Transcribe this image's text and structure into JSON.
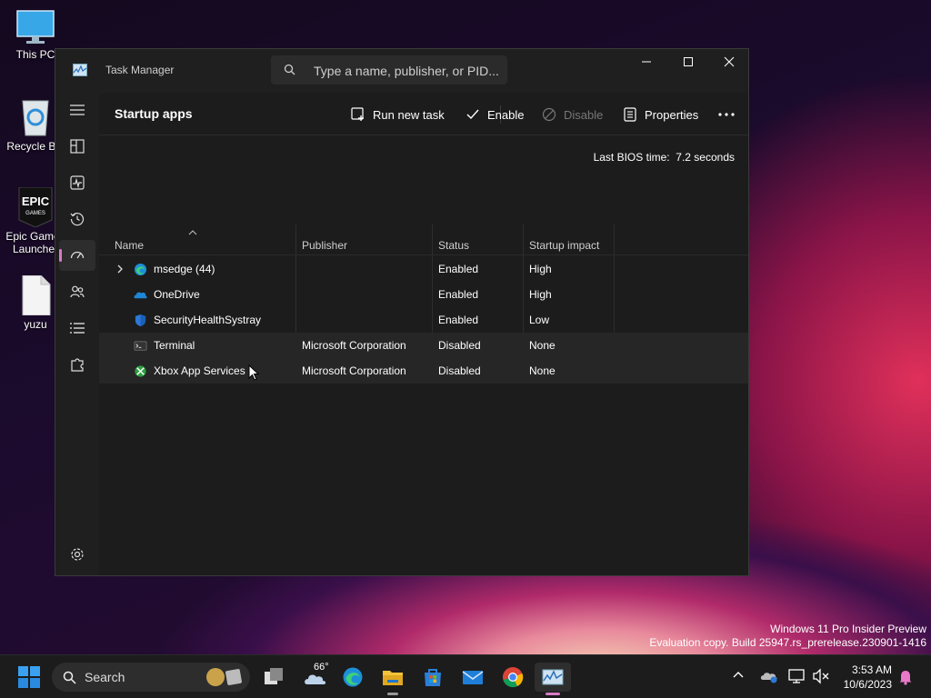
{
  "desktop": {
    "icons": [
      {
        "label": "This PC"
      },
      {
        "label": "Recycle Bin"
      },
      {
        "label": "Epic Games Launcher"
      },
      {
        "label": "yuzu"
      }
    ],
    "watermark": {
      "line1": "Windows 11 Pro Insider Preview",
      "line2": "Evaluation copy. Build 25947.rs_prerelease.230901-1416"
    }
  },
  "window": {
    "title": "Task Manager",
    "search_placeholder": "Type a name, publisher, or PID...",
    "page_title": "Startup apps",
    "toolbar": {
      "run_new_task": "Run new task",
      "enable": "Enable",
      "disable": "Disable",
      "properties": "Properties"
    },
    "bios_label": "Last BIOS time:",
    "bios_value": "7.2 seconds",
    "columns": [
      "Name",
      "Publisher",
      "Status",
      "Startup impact"
    ],
    "rows": [
      {
        "name": "msedge (44)",
        "publisher": "",
        "status": "Enabled",
        "impact": "High",
        "icon": "edge-icon"
      },
      {
        "name": "OneDrive",
        "publisher": "",
        "status": "Enabled",
        "impact": "High",
        "icon": "onedrive-icon"
      },
      {
        "name": "SecurityHealthSystray",
        "publisher": "",
        "status": "Enabled",
        "impact": "Low",
        "icon": "shield-icon"
      },
      {
        "name": "Terminal",
        "publisher": "Microsoft Corporation",
        "status": "Disabled",
        "impact": "None",
        "icon": "terminal-icon"
      },
      {
        "name": "Xbox App Services",
        "publisher": "Microsoft Corporation",
        "status": "Disabled",
        "impact": "None",
        "icon": "xbox-icon"
      }
    ]
  },
  "taskbar": {
    "search_label": "Search",
    "weather_temp": "66°",
    "time": "3:53 AM",
    "date": "10/6/2023"
  },
  "colors": {
    "accent": "#d97bc4",
    "window_bg": "#202020"
  }
}
